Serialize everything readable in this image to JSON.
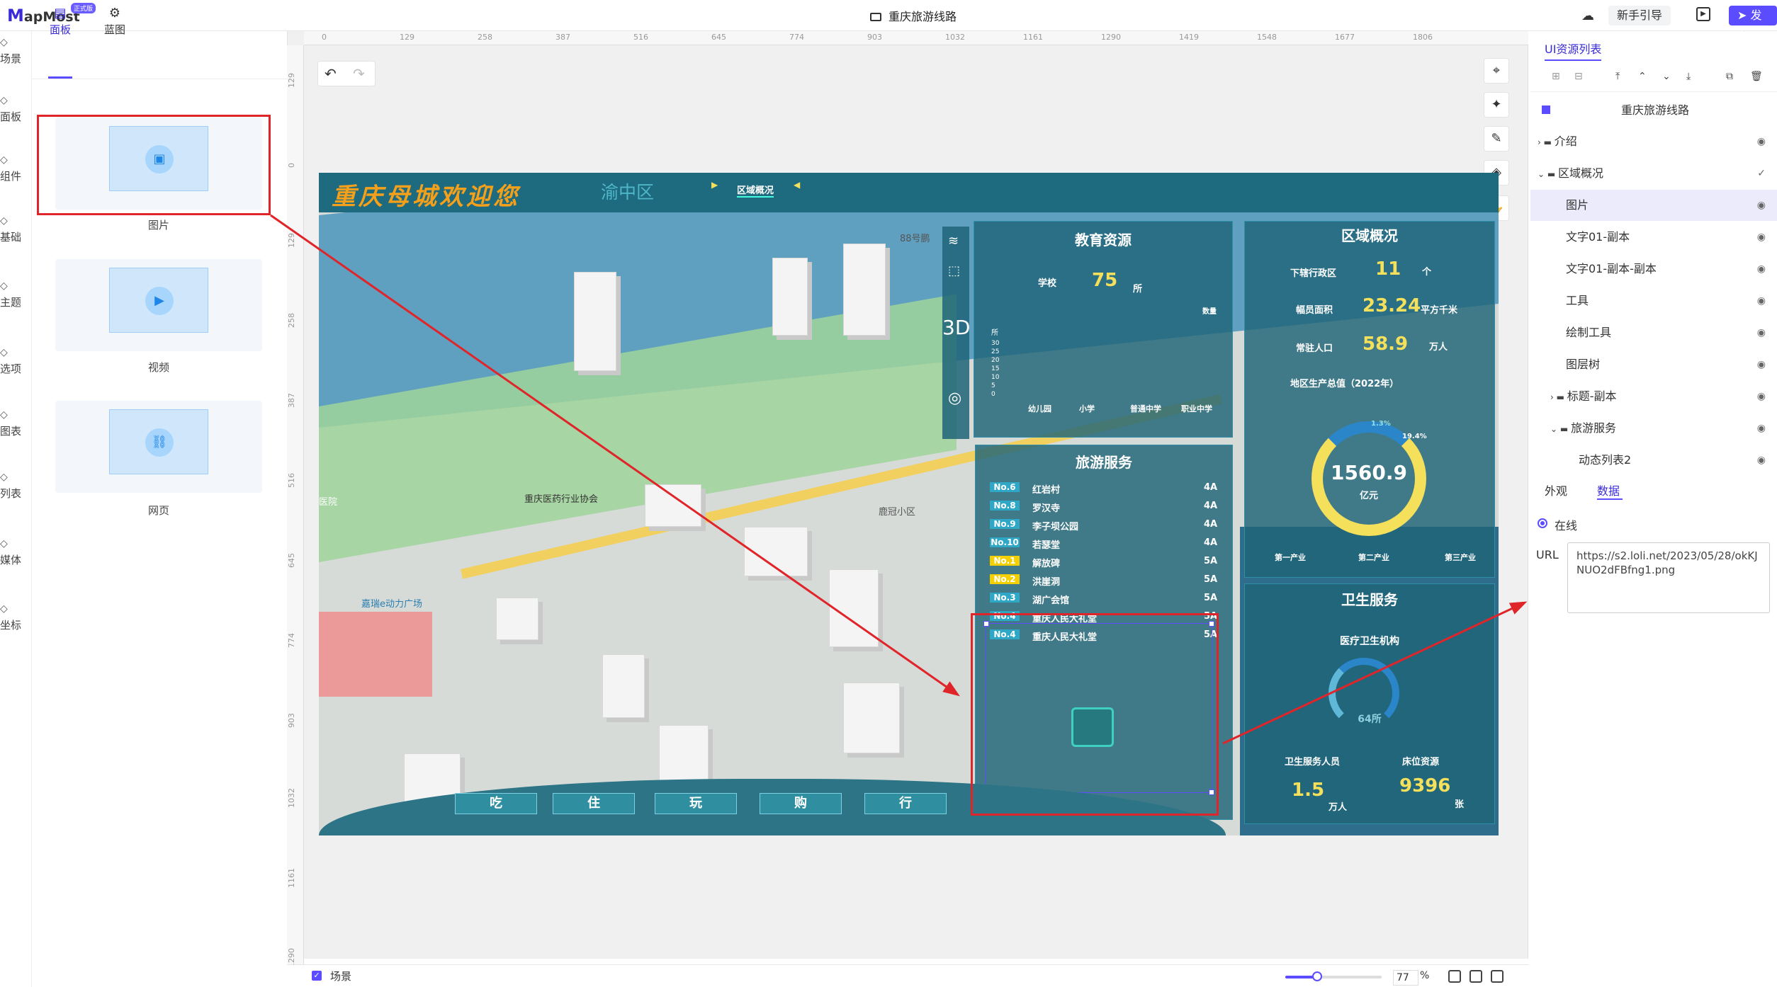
{
  "app": {
    "logo_prefix": "M",
    "logo_name": "apMost",
    "badge": "正式版",
    "title": "重庆旅游线路"
  },
  "topbar": {
    "guide_label": "新手引导",
    "publish_label": "发布"
  },
  "rail": [
    {
      "label": "场景",
      "icon": "globe-icon"
    },
    {
      "label": "面板",
      "icon": "layers-icon"
    },
    {
      "label": "组件",
      "icon": "component-icon"
    },
    {
      "label": "基础",
      "icon": "shape-icon"
    },
    {
      "label": "主题",
      "icon": "chart-icon"
    },
    {
      "label": "选项",
      "icon": "settings-icon"
    },
    {
      "label": "图表",
      "icon": "bar-chart-icon"
    },
    {
      "label": "列表",
      "icon": "list-icon"
    },
    {
      "label": "媒体",
      "icon": "media-icon"
    },
    {
      "label": "坐标",
      "icon": "location-icon"
    }
  ],
  "left_tabs": [
    {
      "label": "面板"
    },
    {
      "label": "蓝图"
    }
  ],
  "assets": [
    {
      "label": "图片"
    },
    {
      "label": "视频"
    },
    {
      "label": "网页"
    }
  ],
  "rulers": {
    "top": [
      "0",
      "129",
      "258",
      "387",
      "516",
      "645",
      "774",
      "903",
      "1032",
      "1161",
      "1290",
      "1419",
      "1548",
      "1677",
      "1806"
    ],
    "left": [
      "129",
      "0",
      "129",
      "258",
      "387",
      "516",
      "645",
      "774",
      "903",
      "1032",
      "1161",
      "1290"
    ]
  },
  "dashboard": {
    "title": "重庆母城欢迎您",
    "district": "渝中区",
    "subtab": "区域概况",
    "edu": {
      "title": "教育资源",
      "school_label": "学校",
      "school_value": "75",
      "school_unit": "所",
      "legend": "数量",
      "yunit": "所",
      "yticks": [
        "30",
        "25",
        "20",
        "15",
        "10",
        "5",
        "0"
      ],
      "categories": [
        "幼儿园",
        "小学",
        "普通中学",
        "职业中学"
      ]
    },
    "area": {
      "title": "区域概况",
      "row1_label": "下辖行政区",
      "row1_value": "11",
      "row1_unit": "个",
      "row2_label": "幅员面积",
      "row2_value": "23.24",
      "row2_unit": "平方千米",
      "row3_label": "常驻人口",
      "row3_value": "58.9",
      "row3_unit": "万人",
      "gdp_label": "地区生产总值（2022年）",
      "gdp_value": "1560.9",
      "gdp_unit": "亿元",
      "pct1": "1.3%",
      "pct2": "19.4%",
      "legend": [
        "第一产业",
        "第二产业",
        "第三产业"
      ]
    },
    "tour": {
      "title": "旅游服务",
      "rows": [
        {
          "no": "No.6",
          "name": "红岩村",
          "level": "4A"
        },
        {
          "no": "No.8",
          "name": "罗汉寺",
          "level": "4A"
        },
        {
          "no": "No.9",
          "name": "李子坝公园",
          "level": "4A"
        },
        {
          "no": "No.10",
          "name": "若瑟堂",
          "level": "4A"
        },
        {
          "no": "No.1",
          "name": "解放碑",
          "level": "5A"
        },
        {
          "no": "No.2",
          "name": "洪崖洞",
          "level": "5A"
        },
        {
          "no": "No.3",
          "name": "湖广会馆",
          "level": "5A"
        },
        {
          "no": "No.4",
          "name": "重庆人民大礼堂",
          "level": "5A"
        },
        {
          "no": "No.4",
          "name": "重庆人民大礼堂",
          "level": "5A"
        }
      ]
    },
    "health": {
      "title": "卫生服务",
      "inst_label": "医疗卫生机构",
      "inst_value": "64所",
      "staff_label": "卫生服务人员",
      "staff_value": "1.5",
      "staff_unit": "万人",
      "bed_label": "床位资源",
      "bed_value": "9396",
      "bed_unit": "张"
    },
    "bottom_buttons": [
      "吃",
      "住",
      "玩",
      "购",
      "行"
    ],
    "map_labels": [
      "重庆医药行业协会",
      "嘉瑞e动力广场",
      "88号鹏",
      "鹿冠小区",
      "医院"
    ]
  },
  "right_panel": {
    "tab": "UI资源列表",
    "root": "重庆旅游线路",
    "tree": [
      {
        "label": "介绍",
        "indent": 0,
        "type": "folder"
      },
      {
        "label": "区域概况",
        "indent": 0,
        "type": "folder-open"
      },
      {
        "label": "图片",
        "indent": 1,
        "type": "item"
      },
      {
        "label": "文字01-副本",
        "indent": 1,
        "type": "item"
      },
      {
        "label": "文字01-副本-副本",
        "indent": 1,
        "type": "item"
      },
      {
        "label": "工具",
        "indent": 1,
        "type": "item"
      },
      {
        "label": "绘制工具",
        "indent": 1,
        "type": "item"
      },
      {
        "label": "图层树",
        "indent": 1,
        "type": "item"
      },
      {
        "label": "标题-副本",
        "indent": 1,
        "type": "folder"
      },
      {
        "label": "旅游服务",
        "indent": 1,
        "type": "folder-open"
      },
      {
        "label": "动态列表2",
        "indent": 2,
        "type": "item"
      }
    ],
    "detail_tabs": [
      "外观",
      "数据"
    ],
    "online_label": "在线",
    "url_label": "URL",
    "url_value": "https://s2.loli.net/2023/05/28/okKJNUO2dFBfng1.png"
  },
  "bottombar": {
    "scene_label": "场景",
    "zoom": "77",
    "zoom_unit": "%"
  },
  "colors": {
    "accent": "#5b4dff",
    "annotation_red": "#e0252a",
    "dash_teal": "#1e6b80",
    "dash_yellow": "#f4e05a"
  }
}
